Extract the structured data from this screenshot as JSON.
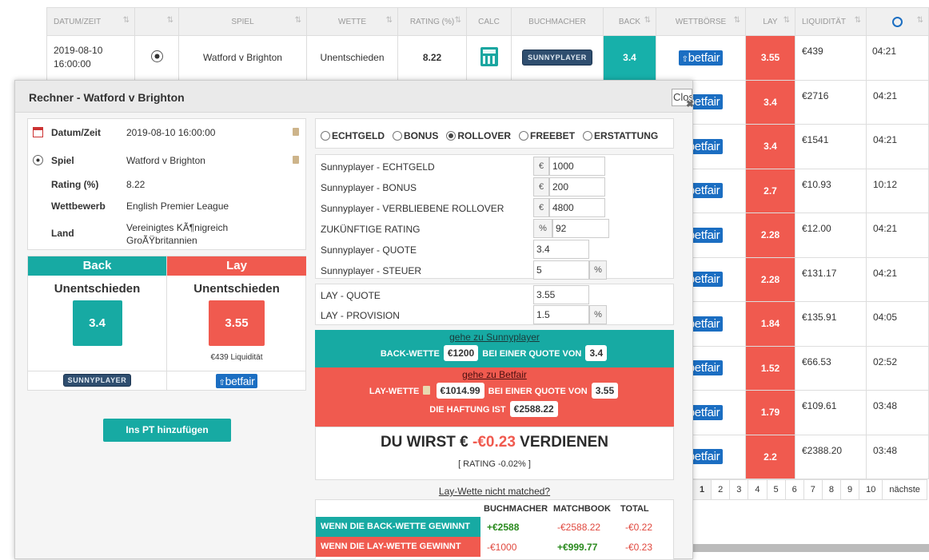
{
  "table": {
    "headers": [
      "DATUM/ZEIT",
      "",
      "SPIEL",
      "WETTE",
      "RATING (%)",
      "CALC",
      "BUCHMACHER",
      "BACK",
      "WETTBÖRSE",
      "LAY",
      "LIQUIDITÄT",
      ""
    ],
    "sort_icon": "⇅",
    "first_row": {
      "datetime": "2019-08-10 16:00:00",
      "match": "Watford v Brighton",
      "bet": "Unentschieden",
      "rating": "8.22",
      "back": "3.4",
      "lay": "3.55",
      "liquidity": "€439",
      "time": "04:21"
    },
    "rows": [
      {
        "lay": "3.4",
        "liquidity": "€2716",
        "time": "04:21"
      },
      {
        "lay": "3.4",
        "liquidity": "€1541",
        "time": "04:21"
      },
      {
        "lay": "2.7",
        "liquidity": "€10.93",
        "time": "10:12"
      },
      {
        "lay": "2.28",
        "liquidity": "€12.00",
        "time": "04:21"
      },
      {
        "lay": "2.28",
        "liquidity": "€131.17",
        "time": "04:21"
      },
      {
        "lay": "1.84",
        "liquidity": "€135.91",
        "time": "04:05"
      },
      {
        "lay": "1.52",
        "liquidity": "€66.53",
        "time": "02:52"
      },
      {
        "lay": "1.79",
        "liquidity": "€109.61",
        "time": "03:48"
      },
      {
        "lay": "2.2",
        "liquidity": "€2388.20",
        "time": "03:48"
      }
    ],
    "pagination": [
      "1",
      "2",
      "3",
      "4",
      "5",
      "6",
      "7",
      "8",
      "9",
      "10",
      "nächste"
    ]
  },
  "logos": {
    "bookmaker": "SUNNYPLAYER",
    "exchange": "betfair",
    "exchange_arrow": "⇧"
  },
  "modal": {
    "title": "Rechner - Watford v Brighton",
    "close_label": "Close",
    "close_x": "✖",
    "info": {
      "datetime_label": "Datum/Zeit",
      "datetime": "2019-08-10 16:00:00",
      "match_label": "Spiel",
      "match": "Watford v Brighton",
      "rating_label": "Rating (%)",
      "rating": "8.22",
      "competition_label": "Wettbewerb",
      "competition": "English Premier League",
      "country_label": "Land",
      "country": "Vereinigtes KÃ¶nigreich GroÃŸbritannien"
    },
    "compare": {
      "back_head": "Back",
      "lay_head": "Lay",
      "back_selection": "Unentschieden",
      "lay_selection": "Unentschieden",
      "back_odds": "3.4",
      "lay_odds": "3.55",
      "lay_liquidity": "€439 Liquidität"
    },
    "add_button": "Ins PT hinzufügen",
    "radio": {
      "options": [
        "ECHTGELD",
        "BONUS",
        "ROLLOVER",
        "FREEBET",
        "ERSTATTUNG"
      ],
      "selected": "ROLLOVER"
    },
    "inputs": {
      "real_label": "Sunnyplayer - ECHTGELD",
      "real": "1000",
      "bonus_label": "Sunnyplayer - BONUS",
      "bonus": "200",
      "rollover_label": "Sunnyplayer - VERBLIEBENE ROLLOVER",
      "rollover": "4800",
      "future_label": "ZUKÜNFTIGE RATING",
      "future": "92",
      "quote_label": "Sunnyplayer - QUOTE",
      "quote": "3.4",
      "tax_label": "Sunnyplayer - STEUER",
      "tax": "5",
      "lay_quote_label": "LAY - QUOTE",
      "lay_quote": "3.55",
      "commission_label": "LAY - PROVISION",
      "commission": "1.5",
      "euro": "€",
      "percent": "%"
    },
    "back_banner": {
      "link": "gehe zu Sunnyplayer",
      "pre": "BACK-WETTE",
      "stake": "€1200",
      "mid": "BEI EINER QUOTE VON",
      "odds": "3.4"
    },
    "lay_banner": {
      "link": "gehe zu Betfair",
      "pre": "LAY-WETTE",
      "stake": "€1014.99",
      "mid": "BEI EINER QUOTE VON",
      "odds": "3.55",
      "liab_label": "DIE HAFTUNG IST",
      "liability": "€2588.22"
    },
    "profit": {
      "pre": "DU WIRST €",
      "amount": "-€0.23",
      "post": "VERDIENEN",
      "rating": "[ RATING -0.02% ]"
    },
    "not_matched": "Lay-Wette nicht matched?",
    "results": {
      "col1": "BUCHMACHER",
      "col2": "MATCHBOOK",
      "col3": "TOTAL",
      "row1": {
        "label": "WENN DIE BACK-WETTE GEWINNT",
        "bm": "+€2588",
        "mb": "-€2588.22",
        "total": "-€0.22"
      },
      "row2": {
        "label": "WENN DIE LAY-WETTE GEWINNT",
        "bm": "-€1000",
        "mb": "+€999.77",
        "total": "-€0.23"
      }
    }
  }
}
